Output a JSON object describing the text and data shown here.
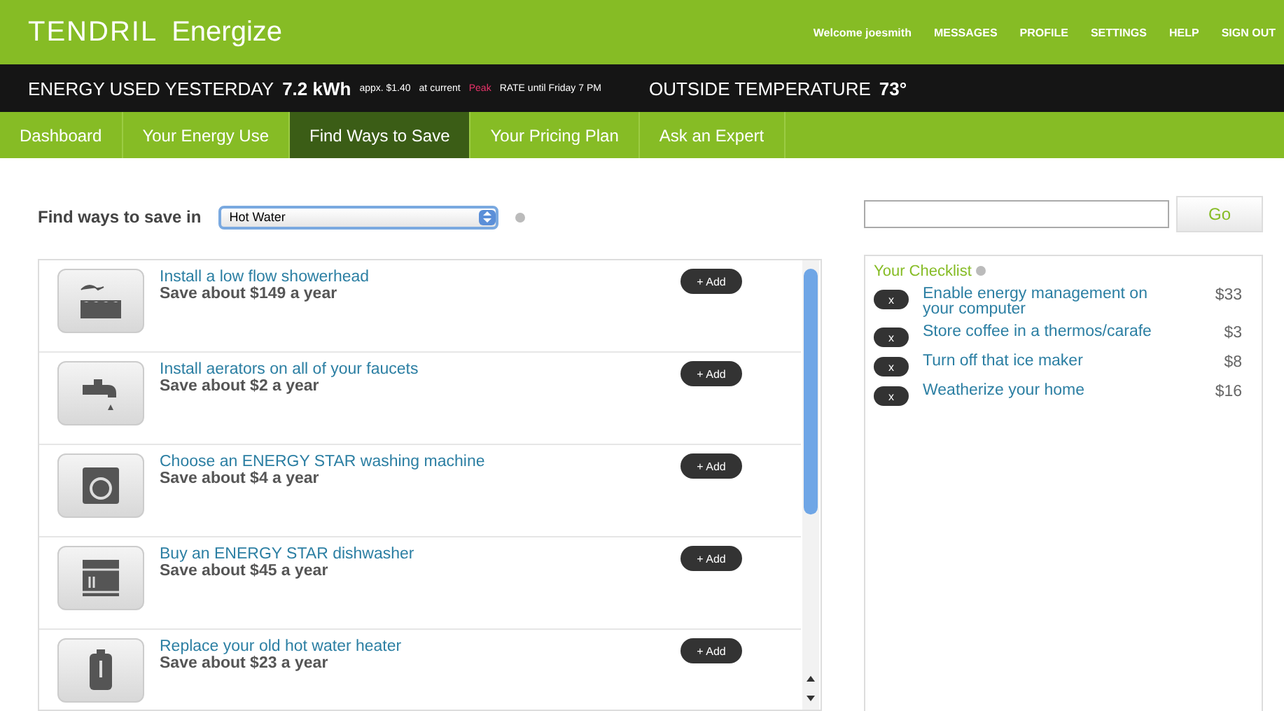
{
  "brand": {
    "logo": "TENDRIL",
    "product": "Energize"
  },
  "top_links": [
    "Welcome joesmith",
    "MESSAGES",
    "PROFILE",
    "SETTINGS",
    "HELP",
    "SIGN OUT"
  ],
  "usage_bar": {
    "label": "ENERGY USED YESTERDAY",
    "value": "7.2 kWh",
    "cost": "appx. $1.40",
    "rate_prefix": "at current",
    "rate_tier": "Peak",
    "rate_suffix": "RATE until Friday 7 PM",
    "temp_label": "OUTSIDE TEMPERATURE",
    "temp_value": "73°"
  },
  "tabs": [
    {
      "label": "Dashboard",
      "selected": false
    },
    {
      "label": "Your Energy Use",
      "selected": false
    },
    {
      "label": "Find Ways to Save",
      "selected": true
    },
    {
      "label": "Your Pricing Plan",
      "selected": false
    },
    {
      "label": "Ask an Expert",
      "selected": false
    }
  ],
  "filter": {
    "label": "Find ways to save in",
    "value": "Hot Water"
  },
  "tips": [
    {
      "kind": "shower",
      "title": "Install a low flow showerhead",
      "saving": "Save about $149 a year",
      "button": "+ Add"
    },
    {
      "kind": "faucet",
      "title": "Install aerators on all of your faucets",
      "saving": "Save about $2 a year",
      "button": "+ Add"
    },
    {
      "kind": "washer",
      "title": "Choose an ENERGY STAR washing machine",
      "saving": "Save about $4 a year",
      "button": "+ Add"
    },
    {
      "kind": "dishwasher",
      "title": "Buy an ENERGY STAR dishwasher",
      "saving": "Save about $45 a year",
      "button": "+ Add"
    },
    {
      "kind": "heater",
      "title": "Replace your old hot water heater",
      "saving": "Save about $23 a year",
      "button": "+ Add"
    }
  ],
  "search": {
    "button": "Go"
  },
  "checklist": {
    "title": "Your Checklist",
    "items": [
      {
        "remove": "x",
        "label": "Enable energy management on your computer",
        "amount": "$33"
      },
      {
        "remove": "x",
        "label": "Store coffee in a thermos/carafe",
        "amount": "$3"
      },
      {
        "remove": "x",
        "label": "Turn off that ice maker",
        "amount": "$8"
      },
      {
        "remove": "x",
        "label": "Weatherize your home",
        "amount": "$16"
      }
    ]
  }
}
